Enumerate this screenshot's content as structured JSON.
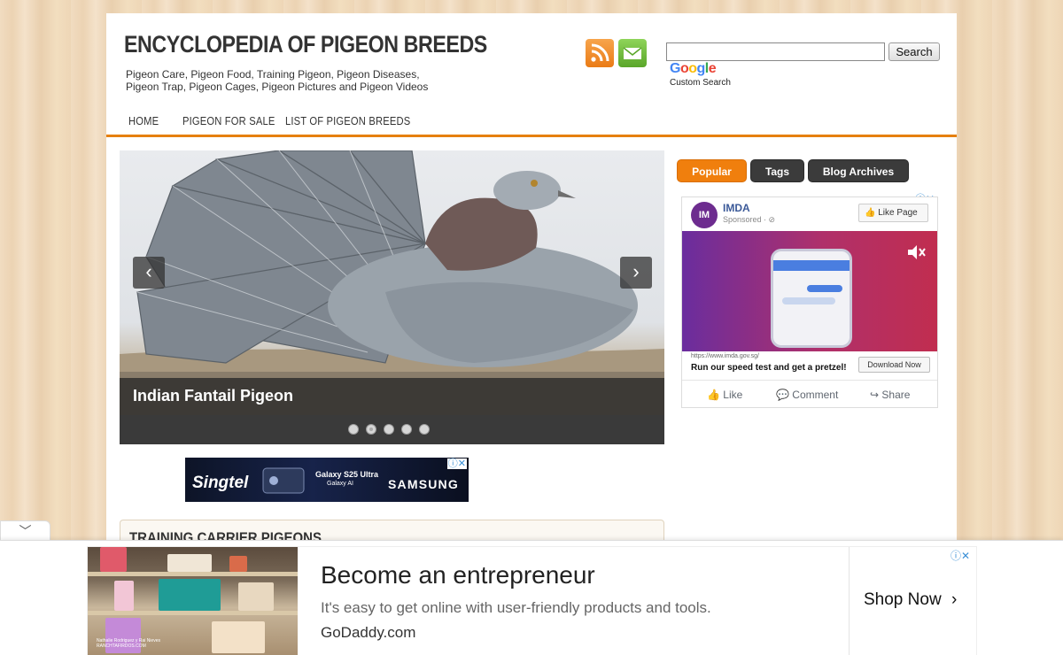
{
  "header": {
    "site_title": "ENCYCLOPEDIA OF PIGEON BREEDS",
    "tagline_line1": "Pigeon Care, Pigeon Food, Training Pigeon, Pigeon Diseases,",
    "tagline_line2": "Pigeon Trap, Pigeon Cages, Pigeon Pictures and Pigeon Videos"
  },
  "search": {
    "value": "",
    "button_label": "Search",
    "google_label": "Google",
    "custom_search_label": "Custom Search"
  },
  "nav": {
    "items": [
      {
        "label": "HOME"
      },
      {
        "label": "PIGEON FOR SALE"
      },
      {
        "label": "LIST OF PIGEON BREEDS"
      }
    ]
  },
  "slider": {
    "caption": "Indian Fantail Pigeon",
    "prev_icon": "chevron-left-icon",
    "next_icon": "chevron-right-icon",
    "dot_count": 5,
    "active_dot": 2
  },
  "ad_small": {
    "brand": "Singtel",
    "product": "Galaxy S25 Ultra",
    "product_sub": "Galaxy AI",
    "partner": "SAMSUNG"
  },
  "section": {
    "title": "TRAINING CARRIER PIGEONS"
  },
  "sidebar": {
    "tabs": [
      {
        "label": "Popular",
        "active": true
      },
      {
        "label": "Tags",
        "active": false
      },
      {
        "label": "Blog Archives",
        "active": false
      }
    ]
  },
  "fb_ad": {
    "logo_text": "IM",
    "advertiser": "IMDA",
    "sponsored": "Sponsored · ⊘",
    "like_page": "Like Page",
    "url": "https://www.imda.gov.sg/",
    "cta_text": "Run our speed test and get a pretzel!",
    "download_label": "Download Now",
    "actions": [
      {
        "label": "Like"
      },
      {
        "label": "Comment"
      },
      {
        "label": "Share"
      }
    ]
  },
  "bottom_ad": {
    "headline": "Become an entrepreneur",
    "subtext": "It's easy to get online with user-friendly products and tools.",
    "domain": "GoDaddy.com",
    "cta": "Shop Now",
    "photo_credit_line1": "Nathalie Rodriguez y Rai Nieves",
    "photo_credit_line2": "RANCHTAFIRDOS.COM"
  },
  "colors": {
    "accent_orange": "#f07f0d",
    "nav_border": "#e6800f",
    "dark_tab": "#3b3b3b",
    "facebook_blue": "#3b5998"
  }
}
